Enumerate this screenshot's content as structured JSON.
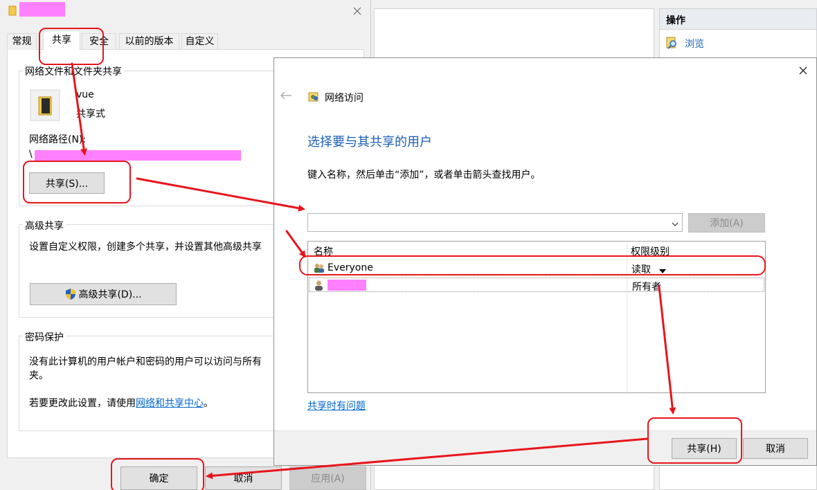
{
  "props": {
    "tabs": [
      "常规",
      "共享",
      "安全",
      "以前的版本",
      "自定义"
    ],
    "network_sharing_title": "网络文件和文件夹共享",
    "folder_name": "vue",
    "folder_state": "共享式",
    "network_path_label": "网络路径(N):",
    "network_path_prefix": "\\",
    "share_button": "共享(S)...",
    "advanced_title": "高级共享",
    "advanced_desc": "设置自定义权限，创建多个共享，并设置其他高级共享",
    "advanced_button": "高级共享(D)...",
    "password_title": "密码保护",
    "password_desc_1": "没有此计算机的用户帐户和密码的用户可以访问与所有",
    "password_desc_2": "夹。",
    "password_change_prefix": "若要更改此设置，请使用",
    "password_change_link": "网络和共享中心",
    "password_change_suffix": "。",
    "ok_button": "确定",
    "cancel_button": "取消",
    "apply_button": "应用(A)"
  },
  "right_pane": {
    "header": "操作",
    "browse": "浏览"
  },
  "dialog": {
    "title": "网络访问",
    "heading": "选择要与其共享的用户",
    "instruction": "键入名称，然后单击“添加”，或者单击箭头查找用户。",
    "input_value": "",
    "add_button": "添加(A)",
    "col_name": "名称",
    "col_permission": "权限级别",
    "rows": [
      {
        "name": "Everyone",
        "permission": "读取"
      },
      {
        "name": "",
        "permission": "所有者"
      }
    ],
    "trouble_link": "共享时有问题",
    "share_button": "共享(H)",
    "cancel_button": "取消"
  },
  "colors": {
    "accent_blue": "#1a5fb4",
    "link_blue": "#0066cc",
    "annotation_red": "#e8141a",
    "redaction_pink": "#ff80ff"
  }
}
